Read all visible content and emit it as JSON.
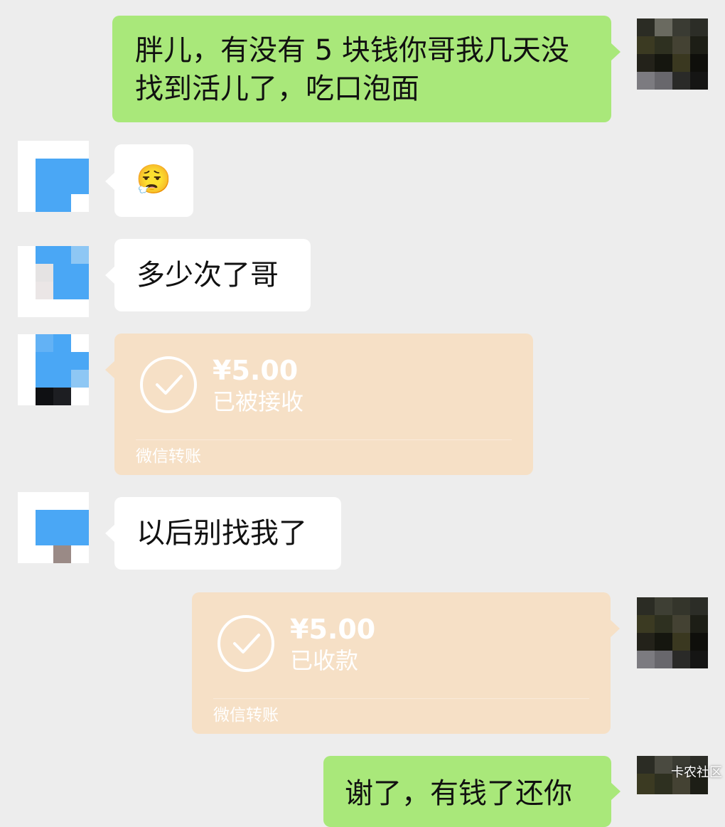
{
  "messages": {
    "m1": {
      "text": "胖儿，有没有 5 块钱你哥我几天没找到活儿了，吃口泡面"
    },
    "m2": {
      "emoji": "😮‍💨"
    },
    "m3": {
      "text": "多少次了哥"
    },
    "m4": {
      "amount": "¥5.00",
      "status": "已被接收",
      "label": "微信转账"
    },
    "m5": {
      "text": "以后别找我了"
    },
    "m6": {
      "amount": "¥5.00",
      "status": "已收款",
      "label": "微信转账"
    },
    "m7": {
      "text": "谢了，有钱了还你"
    }
  },
  "watermark": "卡农社区",
  "colors": {
    "background": "#ededed",
    "sent_bubble": "#a9e87a",
    "received_bubble": "#ffffff",
    "transfer_card": "#f6e0c6",
    "avatar_blue": "#4aa7f5"
  }
}
